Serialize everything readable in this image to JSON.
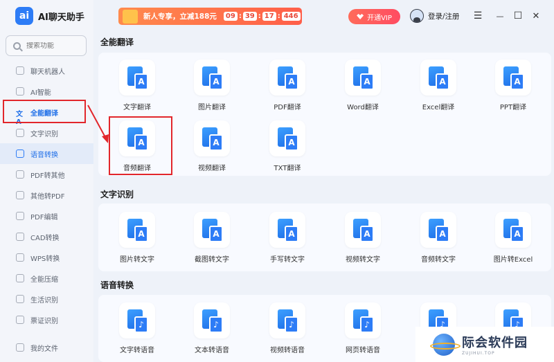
{
  "app": {
    "logo_text": "ai",
    "title": "AI聊天助手"
  },
  "search": {
    "placeholder": "搜索功能"
  },
  "sidebar": {
    "items": [
      {
        "label": "聊天机器人"
      },
      {
        "label": "AI智能"
      },
      {
        "label": "全能翻译",
        "icon": "translate-icon"
      },
      {
        "label": "文字识别"
      },
      {
        "label": "语音转换"
      },
      {
        "label": "PDF转其他"
      },
      {
        "label": "其他转PDF"
      },
      {
        "label": "PDF编辑"
      },
      {
        "label": "CAD转换"
      },
      {
        "label": "WPS转换"
      },
      {
        "label": "全能压缩"
      },
      {
        "label": "生活识别"
      },
      {
        "label": "票证识别"
      }
    ],
    "my_files": "我的文件"
  },
  "topbar": {
    "promo_text": "新人专享，立减188元",
    "timer": [
      "09",
      "39",
      "17",
      "446"
    ],
    "timer_sep": ":",
    "vip_label": "开通VIP",
    "login_label": "登录/注册",
    "menu_glyph": "☰",
    "minimize_glyph": "—",
    "maximize_glyph": "☐",
    "close_glyph": "✕"
  },
  "sections": [
    {
      "title": "全能翻译",
      "tools": [
        {
          "label": "文字翻译",
          "glyph": "文"
        },
        {
          "label": "图片翻译",
          "glyph": "▲"
        },
        {
          "label": "PDF翻译",
          "glyph": "P"
        },
        {
          "label": "Word翻译",
          "glyph": "W"
        },
        {
          "label": "Excel翻译",
          "glyph": "X"
        },
        {
          "label": "PPT翻译",
          "glyph": "◔"
        },
        {
          "label": "音频翻译",
          "glyph": "))"
        },
        {
          "label": "视频翻译",
          "glyph": "▶"
        },
        {
          "label": "TXT翻译",
          "glyph": "T"
        }
      ]
    },
    {
      "title": "文字识别",
      "tools": [
        {
          "label": "图片转文字",
          "glyph": "▲"
        },
        {
          "label": "截图转文字",
          "glyph": "✂"
        },
        {
          "label": "手写转文字",
          "glyph": "✎"
        },
        {
          "label": "视频转文字",
          "glyph": "▶"
        },
        {
          "label": "音频转文字",
          "glyph": "))"
        },
        {
          "label": "图片转Excel",
          "glyph": "✕"
        }
      ]
    },
    {
      "title": "语音转换",
      "tools": [
        {
          "label": "文字转语音",
          "glyph": "文"
        },
        {
          "label": "文本转语音",
          "glyph": "≡"
        },
        {
          "label": "视频转语音",
          "glyph": "▶"
        },
        {
          "label": "网页转语音",
          "glyph": "</>"
        },
        {
          "label": "",
          "glyph": "▲"
        },
        {
          "label": "",
          "glyph": "☺"
        }
      ]
    }
  ],
  "watermark": {
    "title": "际会软件园",
    "subtitle": "ZUJIHUI.TOP"
  },
  "colors": {
    "accent": "#2d7cf6",
    "highlight_border": "#e2262b",
    "vip": "#ff4c62"
  }
}
